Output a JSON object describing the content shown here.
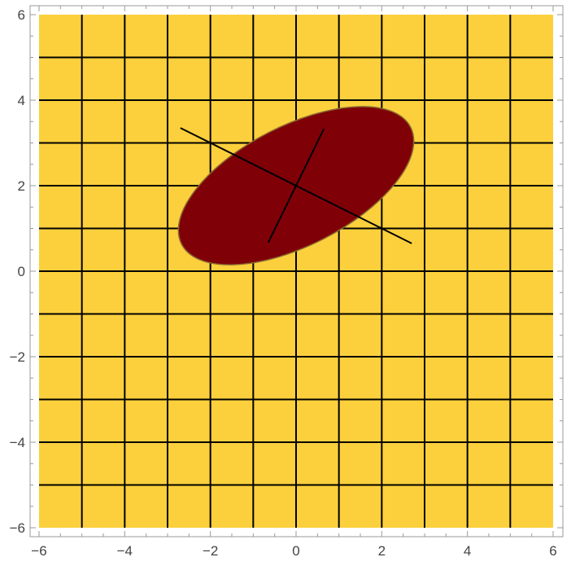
{
  "chart_data": {
    "type": "other",
    "title": "",
    "xlabel": "",
    "ylabel": "",
    "xlim": [
      -6,
      6
    ],
    "ylim": [
      -6,
      6
    ],
    "grid": true,
    "grid_lines": [
      -5,
      -4,
      -3,
      -2,
      -1,
      0,
      1,
      2,
      3,
      4,
      5
    ],
    "x_ticks": [
      -6,
      -4,
      -2,
      0,
      2,
      4,
      6
    ],
    "y_ticks": [
      -6,
      -4,
      -2,
      0,
      2,
      4,
      6
    ],
    "x_tick_labels": [
      "−6",
      "−4",
      "−2",
      "0",
      "2",
      "4",
      "6"
    ],
    "y_tick_labels": [
      "−6",
      "−4",
      "−2",
      "0",
      "2",
      "4",
      "6"
    ],
    "ellipse": {
      "center": [
        0,
        2
      ],
      "semi_major": 3,
      "semi_minor": 1.4,
      "angle_deg": -27,
      "major_axis_segment": [
        [
          -2.7,
          3.35
        ],
        [
          2.7,
          0.65
        ]
      ],
      "minor_axis_segment": [
        [
          -0.65,
          0.67
        ],
        [
          0.65,
          3.33
        ]
      ]
    },
    "colors": {
      "background": "#fcd03c",
      "ellipse_fill": "#800008",
      "ellipse_stroke": "#8a6a30",
      "grid": "#000000",
      "frame": "#999999"
    }
  }
}
